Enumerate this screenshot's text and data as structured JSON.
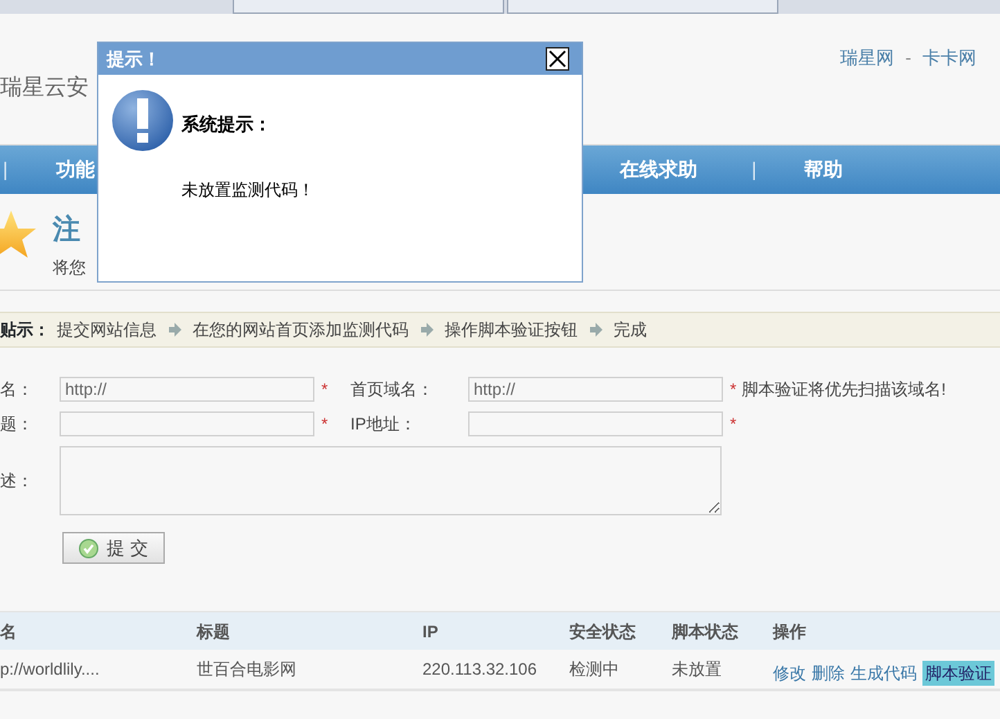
{
  "header": {
    "site_name": "瑞星云安",
    "links": [
      {
        "label": "瑞星网",
        "kind": "link"
      },
      {
        "label": "-",
        "kind": "separator"
      },
      {
        "label": "卡卡网",
        "kind": "link"
      }
    ]
  },
  "nav": [
    {
      "kind": "separator",
      "label": "|"
    },
    {
      "kind": "link",
      "label": "功能"
    },
    {
      "kind": "link",
      "label": "在线求助"
    },
    {
      "kind": "separator",
      "label": "|"
    },
    {
      "kind": "link",
      "label": "帮助"
    }
  ],
  "page_title": {
    "title": "注",
    "subtitle": "将您"
  },
  "steps": {
    "label": "贴示：",
    "items": [
      "提交网站信息",
      "在您的网站首页添加监测代码",
      "操作脚本验证按钮",
      "完成"
    ]
  },
  "form": {
    "rows": [
      {
        "label": "名：",
        "value": "http://",
        "mark": "*",
        "label2": "首页域名：",
        "value2": "http://",
        "mark2": "*",
        "note": "脚本验证将优先扫描该域名!"
      },
      {
        "label": "题：",
        "value": "",
        "mark": "*",
        "label2": "IP地址：",
        "value2": "",
        "mark2": "*"
      },
      {
        "label": "述：",
        "kind": "textarea"
      }
    ],
    "submit": "提 交"
  },
  "table": {
    "columns": [
      "名",
      "标题",
      "IP",
      "安全状态",
      "脚本状态",
      "操作"
    ],
    "rows": [
      {
        "cells": [
          "p://worldlily....",
          "世百合电影网",
          "220.113.32.106",
          "检测中",
          "未放置"
        ],
        "actions": [
          {
            "kind": "link",
            "label": "修改"
          },
          {
            "kind": "link",
            "label": "删除"
          },
          {
            "kind": "link",
            "label": "生成代码"
          },
          {
            "kind": "button",
            "label": "脚本验证"
          }
        ]
      }
    ]
  },
  "dialog": {
    "title": "提示！",
    "heading": "系统提示：",
    "message": "未放置监测代码！"
  }
}
